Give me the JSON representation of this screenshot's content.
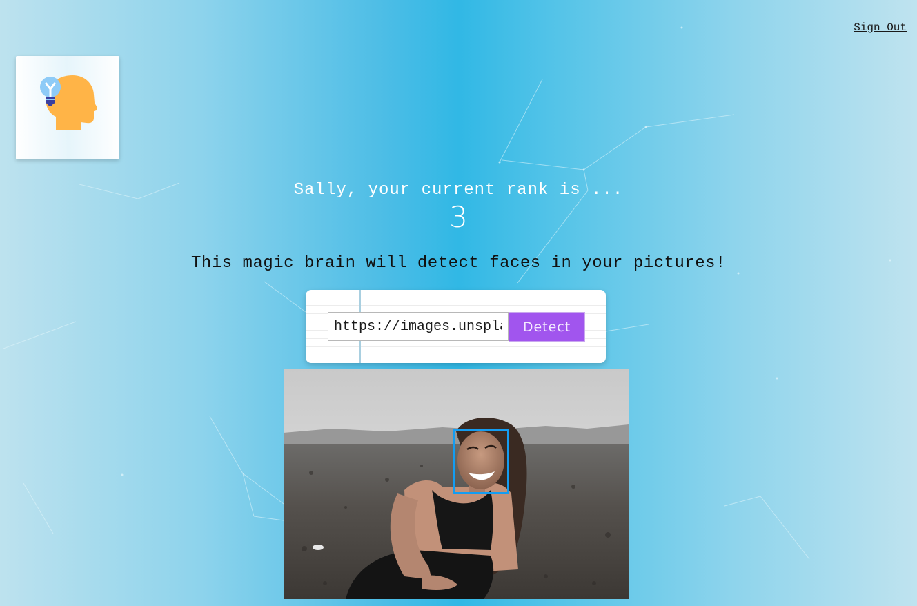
{
  "header": {
    "signout_label": "Sign Out"
  },
  "logo": {
    "icon": "brain-lightbulb-icon"
  },
  "rank": {
    "message": "Sally, your current rank is ...",
    "value": "3"
  },
  "tagline": "This magic brain will detect faces in your pictures!",
  "form": {
    "url_value": "https://images.unsplash.com/photo",
    "detect_label": "Detect"
  },
  "colors": {
    "accent": "#a155ee",
    "face_box": "#149df2",
    "background": "#31b8e5"
  }
}
